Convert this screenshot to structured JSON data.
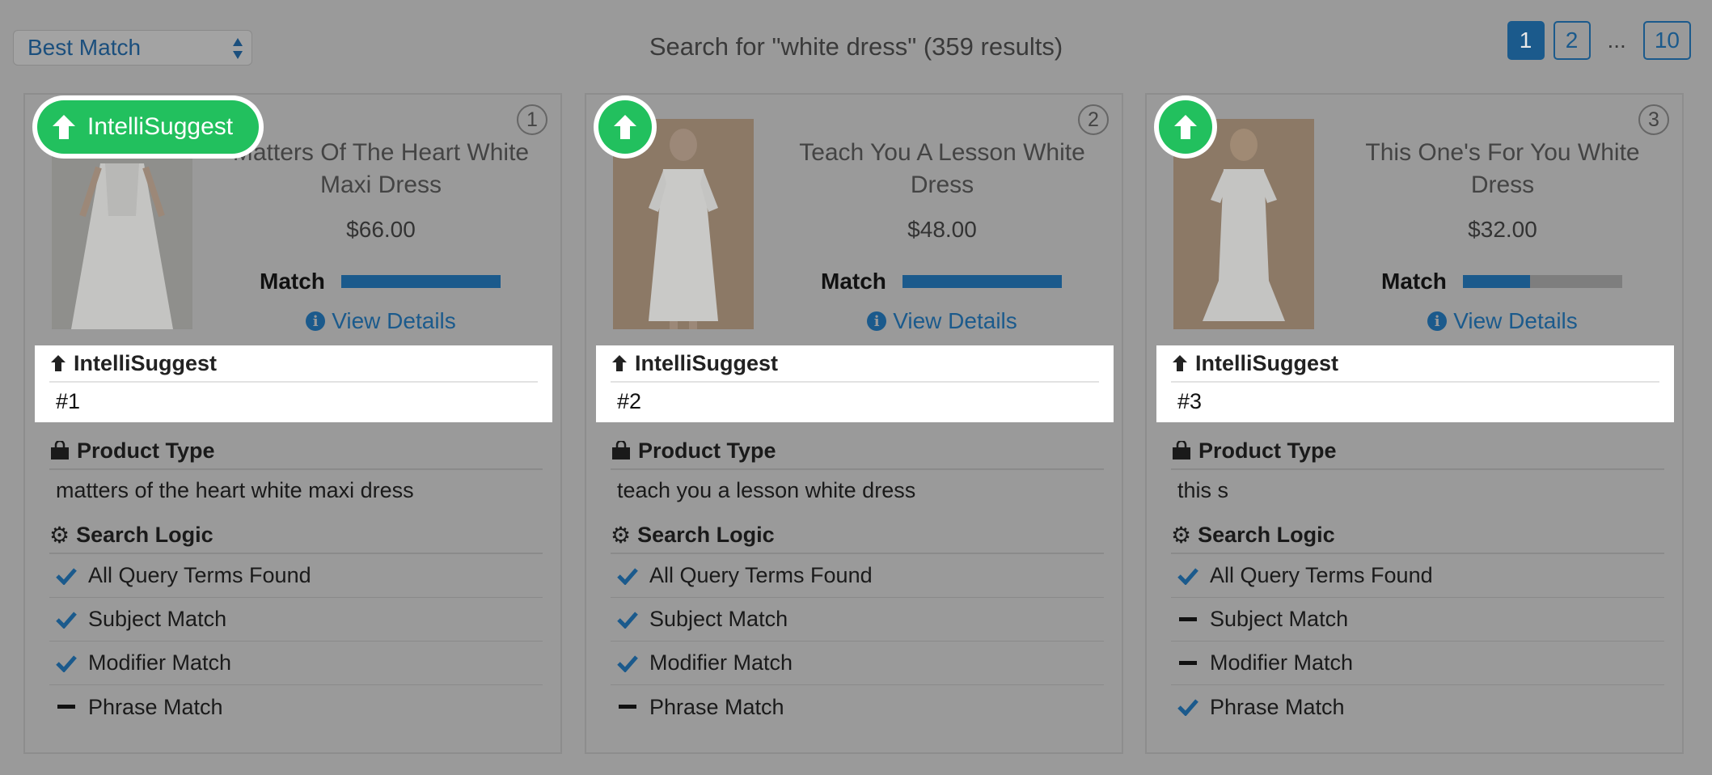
{
  "toolbar": {
    "sort_value": "Best Match",
    "summary": "Search for \"white dress\" (359 results)"
  },
  "pagination": {
    "pages": [
      "1",
      "2",
      "10"
    ],
    "ellipsis": "...",
    "current": "1"
  },
  "colors": {
    "accent_blue": "#1b5a8c",
    "badge_green": "#22c05e",
    "overlay_gray": "#9a9a9a"
  },
  "badge_label": "IntelliSuggest",
  "labels": {
    "match": "Match",
    "view_details": "View Details",
    "intellisuggest": "IntelliSuggest",
    "product_type": "Product Type",
    "search_logic": "Search Logic"
  },
  "products": [
    {
      "rank": "1",
      "title": "Matters Of The Heart White Maxi Dress",
      "price": "$66.00",
      "match_fraction": 1.0,
      "intellisuggest_rank": "#1",
      "product_type": "matters of the heart white maxi dress",
      "logic": [
        {
          "label": "All Query Terms Found",
          "state": "check"
        },
        {
          "label": "Subject Match",
          "state": "check"
        },
        {
          "label": "Modifier Match",
          "state": "check"
        },
        {
          "label": "Phrase Match",
          "state": "dash"
        }
      ]
    },
    {
      "rank": "2",
      "title": "Teach You A Lesson White Dress",
      "price": "$48.00",
      "match_fraction": 1.0,
      "intellisuggest_rank": "#2",
      "product_type": "teach you a lesson white dress",
      "logic": [
        {
          "label": "All Query Terms Found",
          "state": "check"
        },
        {
          "label": "Subject Match",
          "state": "check"
        },
        {
          "label": "Modifier Match",
          "state": "check"
        },
        {
          "label": "Phrase Match",
          "state": "dash"
        }
      ]
    },
    {
      "rank": "3",
      "title": "This One's For You White Dress",
      "price": "$32.00",
      "match_fraction": 0.42,
      "intellisuggest_rank": "#3",
      "product_type": "this s",
      "logic": [
        {
          "label": "All Query Terms Found",
          "state": "check"
        },
        {
          "label": "Subject Match",
          "state": "dash"
        },
        {
          "label": "Modifier Match",
          "state": "dash"
        },
        {
          "label": "Phrase Match",
          "state": "check"
        }
      ]
    }
  ]
}
